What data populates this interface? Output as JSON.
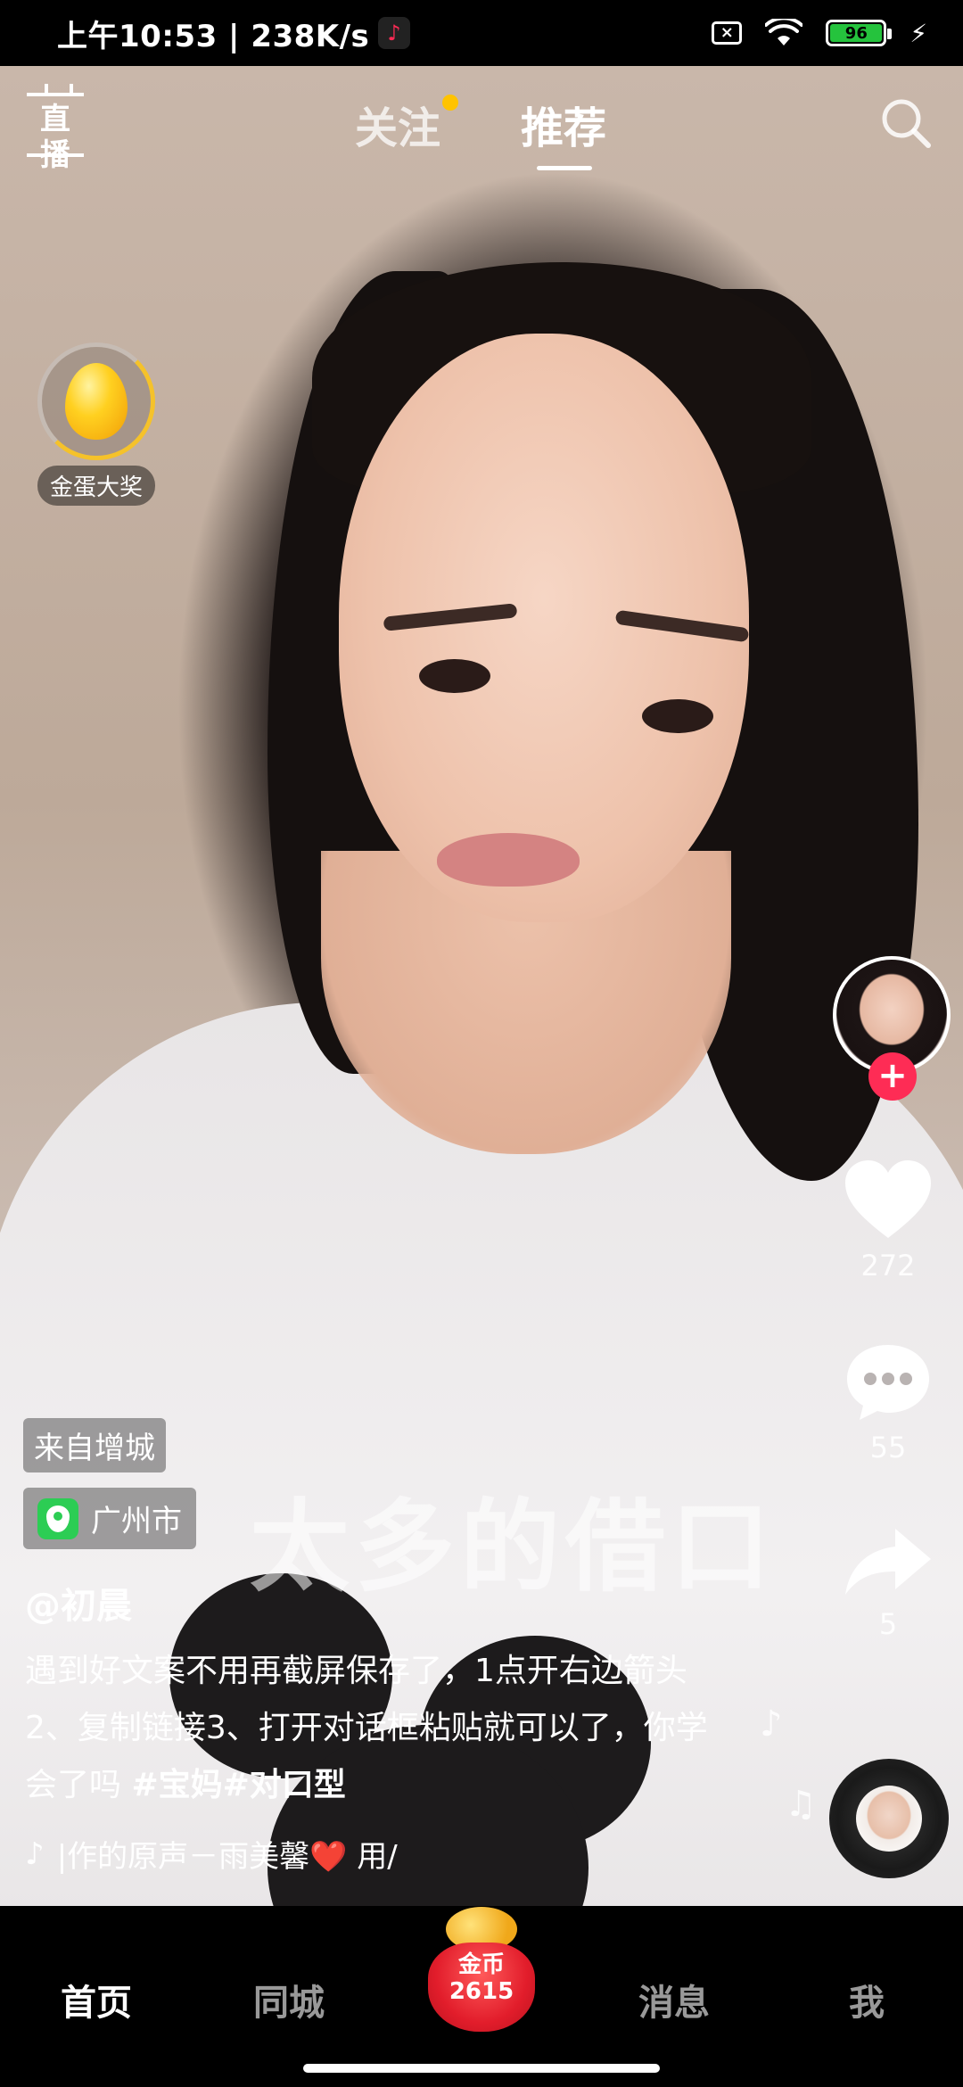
{
  "status_bar": {
    "time_speed": "上午10:53 | 238K/s",
    "battery_level": "96",
    "battery_color": "#25c33d"
  },
  "top_nav": {
    "live_label": "直播",
    "tab_follow": "关注",
    "tab_recommend": "推荐",
    "follow_dot_color": "#ffc300",
    "active_tab": "推荐"
  },
  "egg_widget": {
    "label": "金蛋大奖"
  },
  "video": {
    "watermark_text": "太多的借口"
  },
  "right_rail": {
    "like_count": "272",
    "comment_count": "55",
    "share_count": "5",
    "follow_color": "#fe2c55"
  },
  "overlay": {
    "source_tag": "来自增城",
    "location": "广州市",
    "author": "@初晨",
    "caption_text": "遇到好文案不用再截屏保存了，1点开右边箭头2、复制链接3、打开对话框粘贴就可以了，你学会了吗 ",
    "hashtags": "#宝妈#对口型",
    "music_text": "|作的原声－雨美馨❤️ 用/"
  },
  "bottom_nav": {
    "home": "首页",
    "nearby": "同城",
    "coin_label": "金币",
    "coin_count": "2615",
    "messages": "消息",
    "me": "我"
  }
}
